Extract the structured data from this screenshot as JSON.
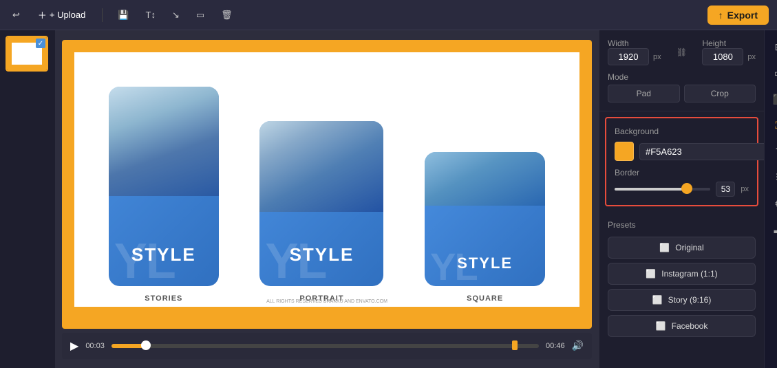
{
  "toolbar": {
    "upload_label": "+ Upload",
    "export_label": "Export"
  },
  "canvas": {
    "background_color": "#f5a623",
    "cards": [
      {
        "title": "STYLE",
        "bg_text": "YL",
        "label": "STORIES"
      },
      {
        "title": "STYLE",
        "bg_text": "YL",
        "label": "PORTRAIT"
      },
      {
        "title": "STYLE",
        "bg_text": "YL",
        "label": "SQUARE"
      }
    ],
    "copyright": "ALL RIGHTS RESERVED BRAKKU AND ENVATO.COM"
  },
  "timeline": {
    "current_time": "00:03",
    "end_time": "00:46"
  },
  "properties": {
    "width_label": "Width",
    "height_label": "Height",
    "width_value": "1920",
    "height_value": "1080",
    "px_label": "px",
    "mode_label": "Mode",
    "pad_label": "Pad",
    "crop_label": "Crop",
    "background_label": "Background",
    "color_value": "#F5A623",
    "border_label": "Border",
    "border_value": "53",
    "presets_label": "Presets",
    "preset_original": "Original",
    "preset_instagram": "Instagram (1:1)",
    "preset_story": "Story (9:16)",
    "preset_facebook": "Facebook"
  }
}
